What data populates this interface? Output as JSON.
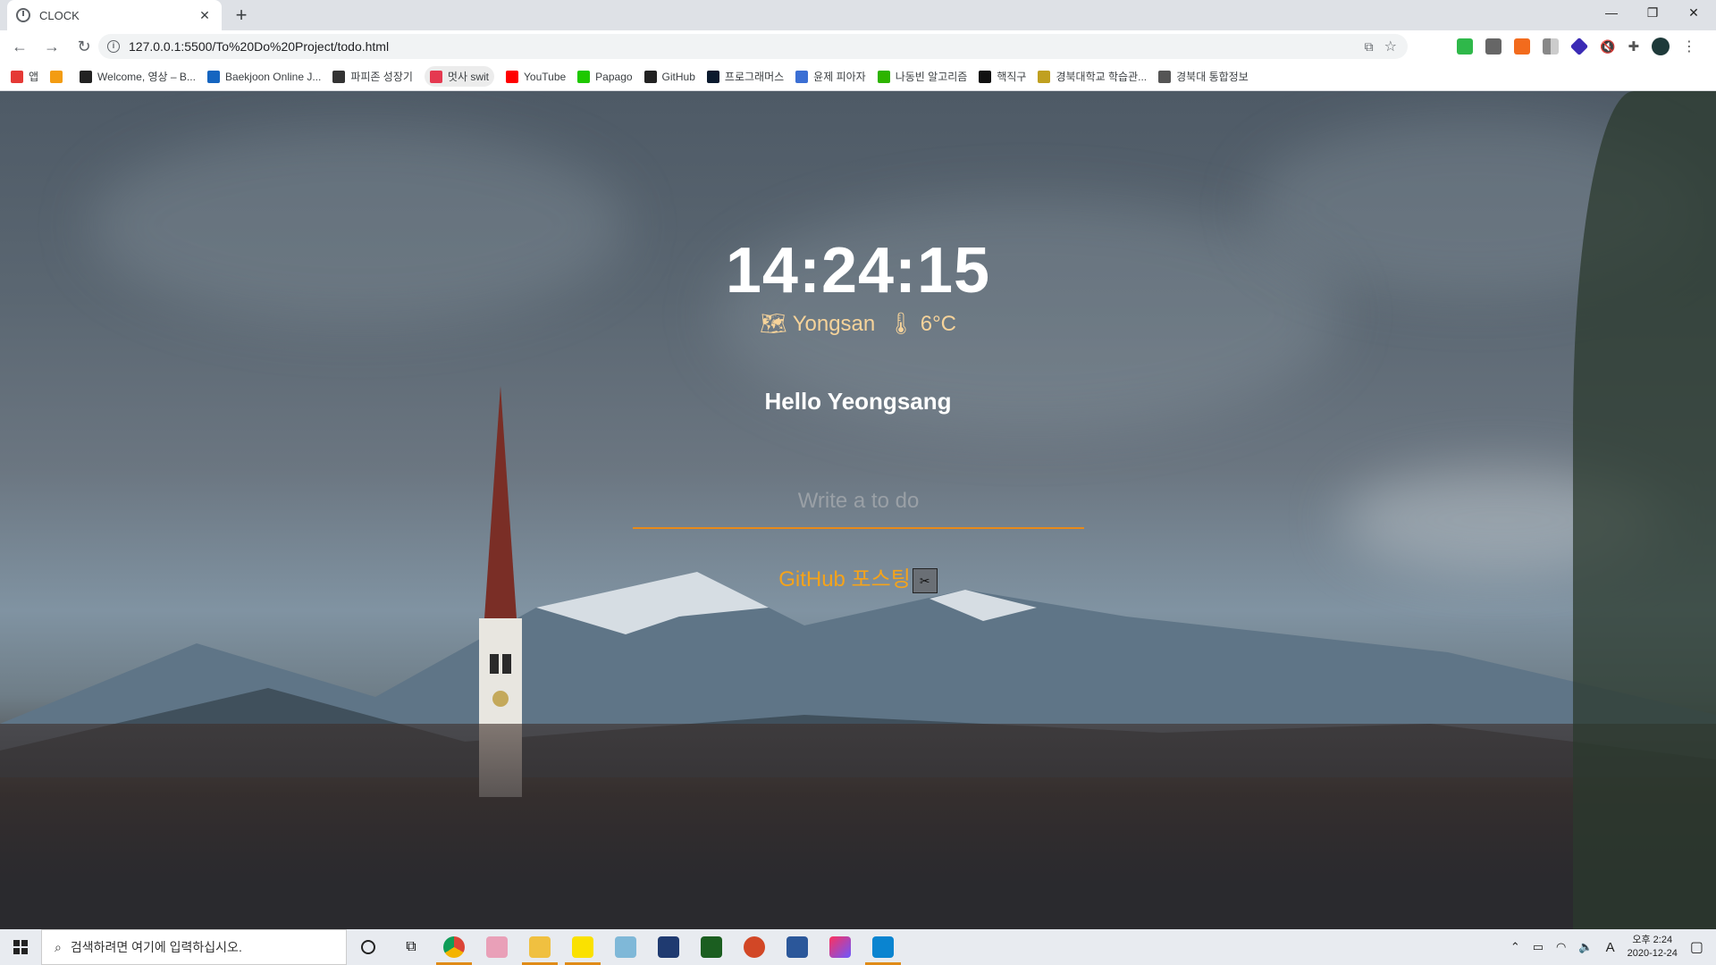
{
  "browser": {
    "tab_title": "CLOCK",
    "url": "127.0.0.1:5500/To%20Do%20Project/todo.html",
    "bookmarks": [
      {
        "label": "앱",
        "icon": "apps-grid-icon",
        "color": "#e53935"
      },
      {
        "label": "",
        "icon": "cloud-icon",
        "color": "#f39c12"
      },
      {
        "label": "Welcome, 영상 – B...",
        "icon": "bb-icon",
        "color": "#222222"
      },
      {
        "label": "Baekjoon Online J...",
        "icon": "code-icon",
        "color": "#1565c0"
      },
      {
        "label": "파피존 성장기",
        "icon": "dots-icon",
        "color": "#333333"
      },
      {
        "label": "멋사 swit",
        "icon": "heart-icon",
        "color": "#e53950"
      },
      {
        "label": "YouTube",
        "icon": "youtube-icon",
        "color": "#ff0000"
      },
      {
        "label": "Papago",
        "icon": "papago-icon",
        "color": "#1ec800"
      },
      {
        "label": "GitHub",
        "icon": "github-icon",
        "color": "#222222"
      },
      {
        "label": "프로그래머스",
        "icon": "programmers-icon",
        "color": "#0b1a2e"
      },
      {
        "label": "윤제 피아자",
        "icon": "p-icon",
        "color": "#3b6fd4"
      },
      {
        "label": "나동빈 알고리즘",
        "icon": "chat-icon",
        "color": "#2db400"
      },
      {
        "label": "핵직구",
        "icon": "h-icon",
        "color": "#111111"
      },
      {
        "label": "경북대학교 학습관...",
        "icon": "knu-icon",
        "color": "#c0a020"
      },
      {
        "label": "경북대 통합정보",
        "icon": "globe-icon",
        "color": "#555555"
      }
    ]
  },
  "app": {
    "time": "14:24:15",
    "weather_icon": "🗺",
    "location": "Yongsan",
    "temp_icon": "🌡",
    "temperature": "6°C",
    "greeting": "Hello Yeongsang",
    "todo_placeholder": "Write a to do",
    "todos": [
      {
        "text": "GitHub 포스팅",
        "delete_label": "✂"
      }
    ],
    "accent": "#e88a1a",
    "todo_color": "#f5a31a"
  },
  "taskbar": {
    "search_placeholder": "검색하려면 여기에 입력하십시오.",
    "time": "오후 2:24",
    "date": "2020-12-24",
    "ime": "A"
  }
}
